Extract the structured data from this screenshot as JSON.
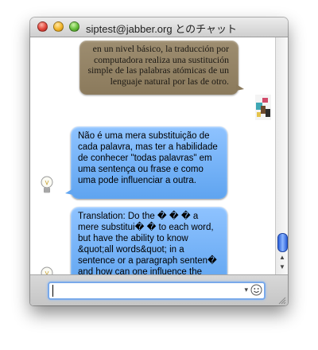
{
  "window": {
    "title": "siptest@jabber.org とのチャット"
  },
  "messages": [
    {
      "text": "en un nivel básico, la traducción por computadora realiza una sustitución simple de las palabras atómicas de un lenguaje natural por las de otro."
    },
    {
      "text": "Não é uma mera substituição de cada palavra, mas ter a habilidade de conhecer \"todas palavras\" em uma sentença ou frase e como uma pode influenciar a outra."
    },
    {
      "text": "Translation: Do the � � � a mere substitui� � to each word, but have the ability to know &quot;all words&quot; in a sentence or a paragraph senten� and how can one influence the other."
    }
  ],
  "input": {
    "value": "",
    "drop_glyph": "▾"
  },
  "icons": [
    "close-icon",
    "minimize-icon",
    "zoom-icon",
    "avatar-icon",
    "lightbulb-icon",
    "smiley-icon",
    "resize-grip-icon"
  ]
}
